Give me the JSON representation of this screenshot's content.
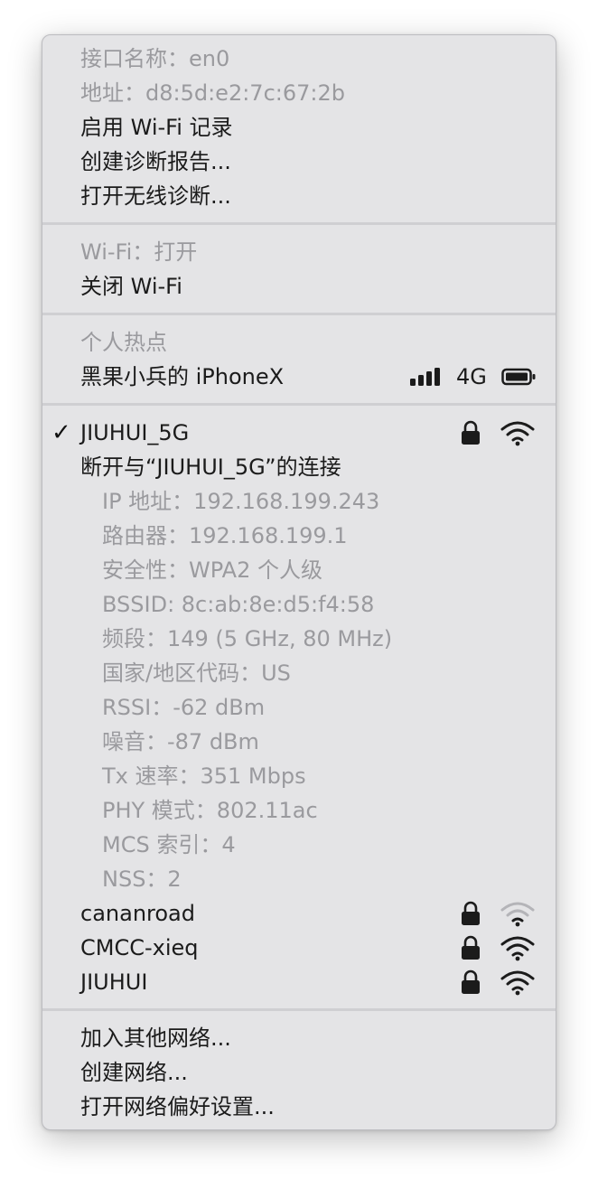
{
  "interface": {
    "name": "接口名称：en0",
    "address": "地址：d8:5d:e2:7c:67:2b",
    "enable_logging": "启用 Wi-Fi 记录",
    "create_report": "创建诊断报告...",
    "open_diagnostics": "打开无线诊断..."
  },
  "wifi_power": {
    "status": "Wi-Fi：打开",
    "toggle": "关闭 Wi-Fi"
  },
  "hotspot": {
    "header": "个人热点",
    "device": "黑果小兵的 iPhoneX",
    "network_type": "4G"
  },
  "current_network": {
    "check": "✓",
    "ssid": "JIUHUI_5G",
    "disconnect": "断开与“JIUHUI_5G”的连接",
    "details": [
      "IP 地址：192.168.199.243",
      "路由器：192.168.199.1",
      "安全性：WPA2 个人级",
      "BSSID: 8c:ab:8e:d5:f4:58",
      "频段：149 (5 GHz, 80 MHz)",
      "国家/地区代码：US",
      "RSSI：-62 dBm",
      "噪音：-87 dBm",
      "Tx 速率：351 Mbps",
      "PHY 模式：802.11ac",
      "MCS 索引：4",
      "NSS：2"
    ]
  },
  "networks": [
    {
      "ssid": "cananroad",
      "secured": true,
      "signal": "weak"
    },
    {
      "ssid": "CMCC-xieq",
      "secured": true,
      "signal": "full"
    },
    {
      "ssid": "JIUHUI",
      "secured": true,
      "signal": "full"
    }
  ],
  "footer": {
    "join_other": "加入其他网络...",
    "create_network": "创建网络...",
    "open_prefs": "打开网络偏好设置..."
  },
  "colors": {
    "menu_bg": "#e4e4e6",
    "text": "#1b1b1b",
    "disabled_text": "#9a9a9e",
    "separator": "#cfcfd2"
  }
}
